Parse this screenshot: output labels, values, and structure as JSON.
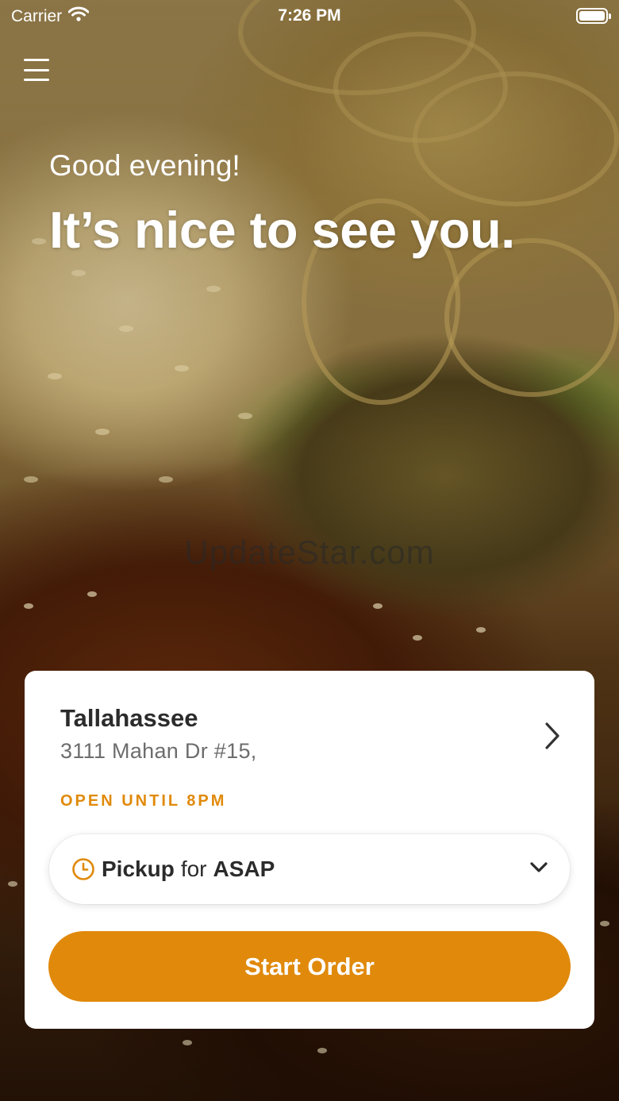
{
  "status_bar": {
    "carrier": "Carrier",
    "time": "7:26 PM"
  },
  "hero": {
    "greeting": "Good evening!",
    "headline": "It’s nice to see you."
  },
  "watermark": "UpdateStar.com",
  "location": {
    "name": "Tallahassee",
    "address": "3111 Mahan Dr #15,",
    "hours": "OPEN UNTIL 8PM"
  },
  "order_type": {
    "mode": "Pickup",
    "connector": "for",
    "time": "ASAP"
  },
  "start_order_label": "Start Order",
  "colors": {
    "accent": "#e0890b",
    "text_dark": "#2b2b2b",
    "text_muted": "#6d6d6d",
    "card_bg": "#ffffff"
  },
  "icons": [
    "wifi-icon",
    "battery-icon",
    "menu-icon",
    "chevron-right-icon",
    "clock-icon",
    "chevron-down-icon"
  ]
}
